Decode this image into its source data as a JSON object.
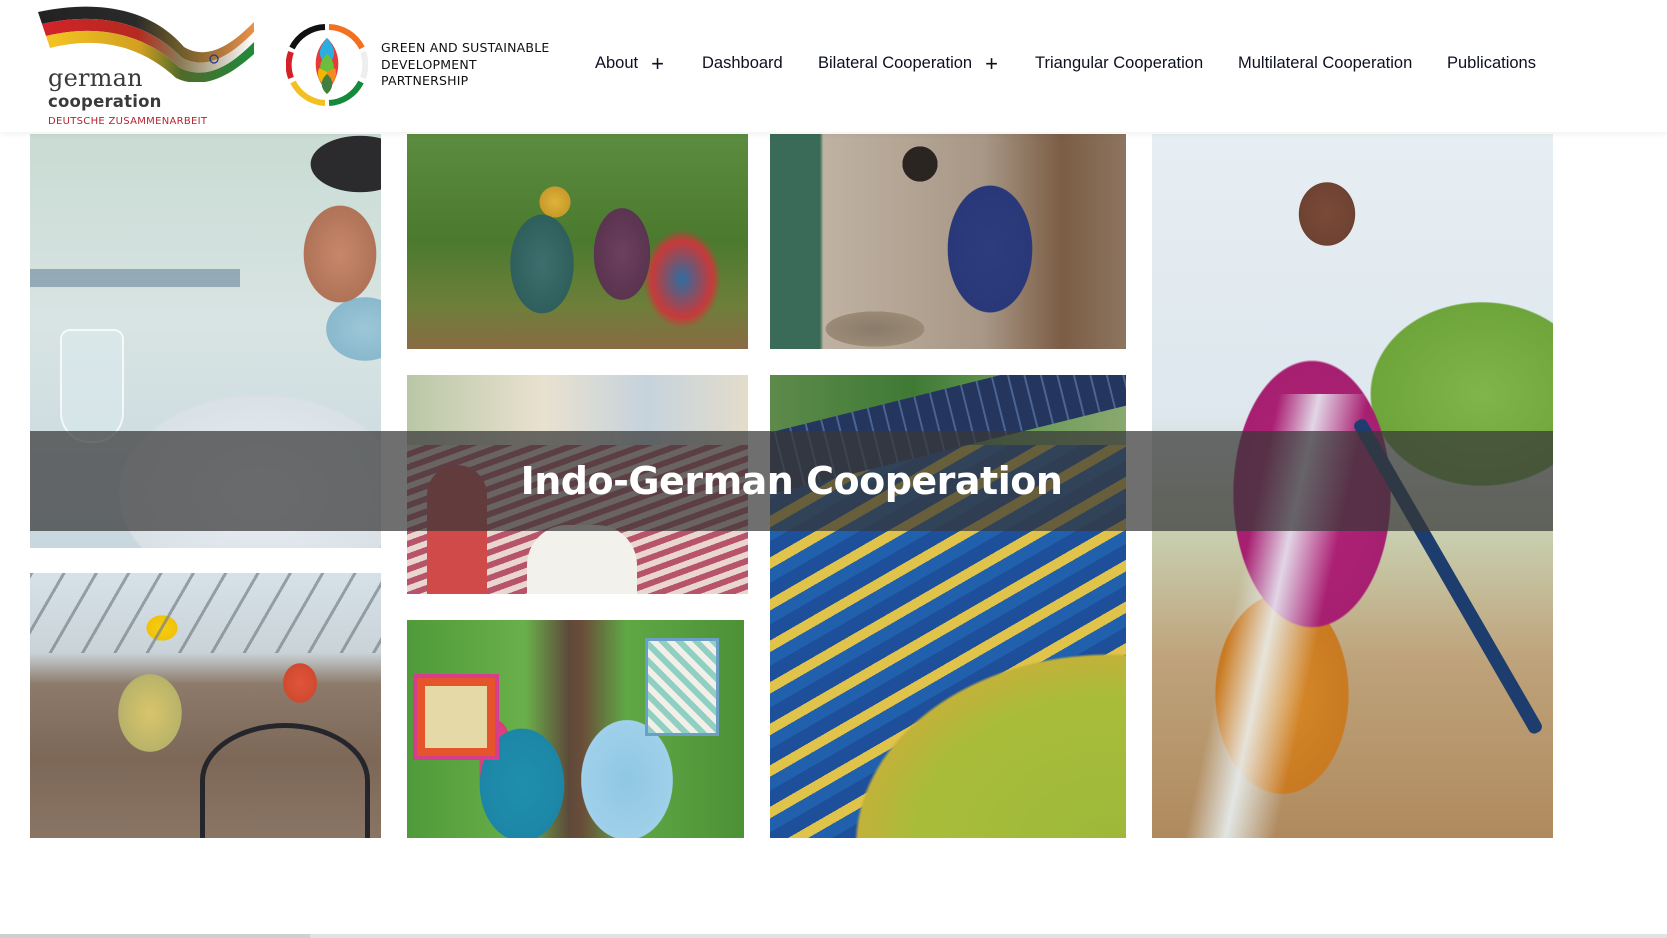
{
  "header": {
    "logo_primary": {
      "line1": "german",
      "line2": "cooperation",
      "line3": "DEUTSCHE ZUSAMMENARBEIT",
      "colors": {
        "text": "#3a3a3a",
        "tagline": "#b4252f"
      }
    },
    "logo_secondary": {
      "lines": [
        "GREEN AND SUSTAINABLE",
        "DEVELOPMENT",
        "PARTNERSHIP"
      ]
    },
    "nav": [
      {
        "label": "About",
        "has_submenu": true,
        "submenu_icon": "plus"
      },
      {
        "label": "Dashboard",
        "has_submenu": false
      },
      {
        "label": "Bilateral Cooperation",
        "has_submenu": true,
        "submenu_icon": "plus"
      },
      {
        "label": "Triangular Cooperation",
        "has_submenu": false
      },
      {
        "label": "Multilateral Cooperation",
        "has_submenu": false
      },
      {
        "label": "Publications",
        "has_submenu": false
      }
    ],
    "plus_glyph": "+"
  },
  "hero": {
    "title": "Indo-German Cooperation",
    "photos": [
      {
        "id": "lab-scientist",
        "subject": "scientist with mask holding flask in laboratory"
      },
      {
        "id": "women-planting",
        "subject": "three women planting a sapling"
      },
      {
        "id": "woman-sieving",
        "subject": "woman sieving grain into basin"
      },
      {
        "id": "community-meeting",
        "subject": "community meeting with raised hands"
      },
      {
        "id": "solar-stadium",
        "subject": "stadium with rooftop solar panels"
      },
      {
        "id": "solar-farm-worker",
        "subject": "women working under solar panels with drip irrigation"
      },
      {
        "id": "women-textiles",
        "subject": "two women holding quilted textiles"
      },
      {
        "id": "woman-watering",
        "subject": "woman in pink sari watering with hose"
      }
    ]
  },
  "colors": {
    "banner_overlay": "#373737",
    "nav_text": "#0d1020",
    "banner_text": "#ffffff"
  }
}
